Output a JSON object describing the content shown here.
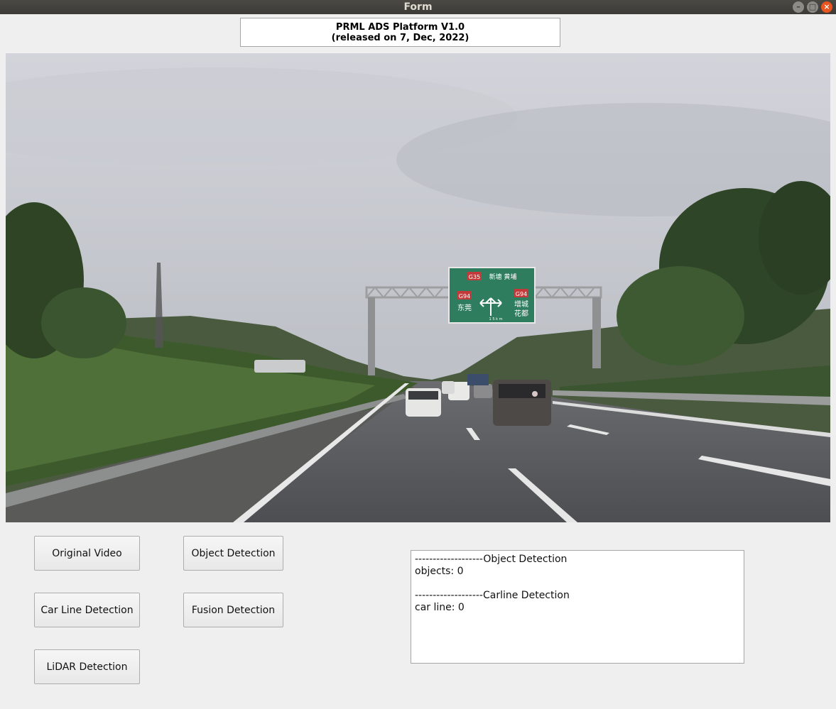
{
  "window": {
    "title": "Form",
    "minimize_symbol": "–",
    "maximize_symbol": "□",
    "close_symbol": "×"
  },
  "header": {
    "line1": "PRML ADS Platform V1.0",
    "line2": "(released on 7, Dec, 2022)"
  },
  "video": {
    "sign": {
      "top_code": "G35",
      "top_text": "新塘 黄埔",
      "left_code": "G94",
      "left_text": "东莞",
      "right_code": "G94",
      "right_text1": "增城",
      "right_text2": "花都",
      "distance": "1 5 k m"
    }
  },
  "buttons": {
    "original_video": "Original Video",
    "object_detection": "Object Detection",
    "car_line_detection": "Car Line Detection",
    "fusion_detection": "Fusion Detection",
    "lidar_detection": "LiDAR Detection"
  },
  "output": {
    "object_header": "-------------------Object Detection",
    "objects_line": "objects: 0",
    "carline_header": "-------------------Carline Detection",
    "carline_line": "car line: 0"
  },
  "colors": {
    "sign_green": "#2e7d5e",
    "sky": "#c7c9cf",
    "road": "#56575b"
  }
}
